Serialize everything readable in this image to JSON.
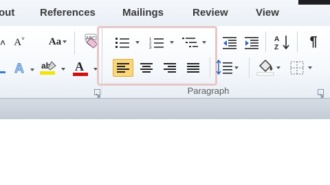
{
  "tabs": {
    "partial_layout": "out",
    "references": "References",
    "mailings": "Mailings",
    "review": "Review",
    "view": "View"
  },
  "ribbon": {
    "font_group": {
      "shrink_font_label": "A",
      "change_case_label": "Aa",
      "highlight_label": "ab",
      "font_color_label": "A",
      "text_effects_label": "A",
      "clear_formatting_label": "ABC"
    },
    "paragraph_group": {
      "label": "Paragraph"
    },
    "show_hide_label": "¶",
    "sort_label": "A Z"
  },
  "colors": {
    "highlight_yellow": "#f2e600",
    "font_color_red": "#d01010",
    "text_effects_blue": "#5b8fd6",
    "align_left_active_bg": "#fbd77a",
    "group_highlight_border": "#e6c7c9"
  }
}
